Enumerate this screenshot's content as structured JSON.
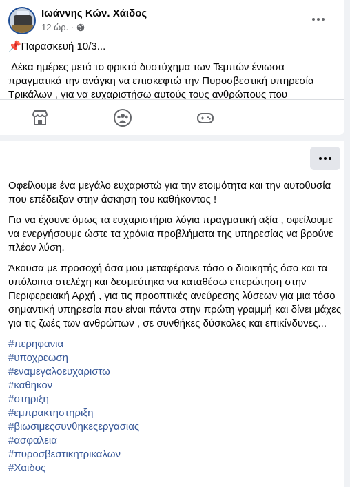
{
  "post": {
    "author": "Ιωάννης Κών. Χάιδος",
    "time": "12 ώρ.",
    "preview_lines": [
      "📌Παρασκευή 10/3...",
      " Δέκα ημέρες μετά το φρικτό δυστύχημα των Τεμπών ένιωσα",
      "πραγματικά την ανάγκη να επισκεφτώ την Πυροσβεστική υπηρεσία",
      "Τρικάλων , για να ευχαριστήσω αυτούς τους ανθρώπους που"
    ]
  },
  "iconbar": {
    "icons": [
      "marketplace-icon",
      "groups-icon",
      "gaming-icon"
    ]
  },
  "expanded": {
    "paragraphs": [
      " Οφείλουμε ένα μεγάλο ευχαριστώ για την ετοιμότητα και την αυτοθυσία που επέδειξαν στην άσκηση του καθήκοντος !",
      " Για να έχουνε όμως τα ευχαριστήρια λόγια πραγματική αξία , οφείλουμε να ενεργήσουμε ώστε τα χρόνια προβλήματα της υπηρεσίας να βρούνε πλέον λύση.",
      " Άκουσα με προσοχή όσα μου μεταφέρανε τόσο ο διοικητής όσο και τα υπόλοιπα στελέχη και δεσμεύτηκα να καταθέσω επερώτηση στην Περιφερειακή Αρχή , για τις προοπτικές ανεύρεσης λύσεων για μια τόσο σημαντική υπηρεσία που είναι πάντα στην πρώτη γραμμή και δίνει μάχες για τις ζωές των ανθρώπων , σε συνθήκες δύσκολες και επικίνδυνες..."
    ],
    "hashtags": [
      "#περηφανια",
      "#υποχρεωση",
      "#εναμεγαλοευχαριστω",
      "#καθηκον",
      "#στηριξη",
      "#εμπρακτηστηριξη",
      "#βιωσιμεςσυνθηκεςεργασιας",
      "#ασφαλεια",
      "#πυροσβεστικητρικαλων",
      "#Χαιδος"
    ]
  },
  "colors": {
    "accent": "#385898",
    "muted": "#65676b"
  }
}
